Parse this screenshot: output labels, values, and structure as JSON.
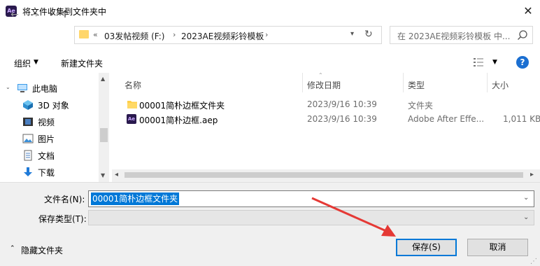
{
  "title": "将文件收集到文件夹中",
  "app_icon_text": "Ae",
  "address": {
    "overflow": "«",
    "crumbs": [
      "03发帖视频 (F:)",
      "2023AE视频彩铃模板"
    ]
  },
  "search": {
    "placeholder": "在 2023AE视频彩铃模板 中..."
  },
  "toolbar": {
    "organize": "组织",
    "new_folder": "新建文件夹"
  },
  "nav": {
    "items": [
      {
        "label": "此电脑",
        "icon": "pc-icon"
      },
      {
        "label": "3D 对象",
        "icon": "3d-objects-icon"
      },
      {
        "label": "视频",
        "icon": "video-icon"
      },
      {
        "label": "图片",
        "icon": "picture-icon"
      },
      {
        "label": "文档",
        "icon": "document-icon"
      },
      {
        "label": "下载",
        "icon": "download-icon"
      }
    ]
  },
  "columns": {
    "name": "名称",
    "modified": "修改日期",
    "type": "类型",
    "size": "大小"
  },
  "files": [
    {
      "name": "00001简朴边框文件夹",
      "modified": "2023/9/16 10:39",
      "type": "文件夹",
      "size": "",
      "icon": "folder-icon"
    },
    {
      "name": "00001简朴边框.aep",
      "modified": "2023/9/16 10:39",
      "type": "Adobe After Effe...",
      "size": "1,011 KB",
      "icon": "ae-file-icon"
    }
  ],
  "form": {
    "filename_label": "文件名(N):",
    "filename_value": "00001简朴边框文件夹",
    "filetype_label": "保存类型(T):"
  },
  "footer": {
    "hide_folders": "隐藏文件夹",
    "save": "保存(S)",
    "cancel": "取消"
  },
  "colors": {
    "accent": "#0078d7",
    "annotation": "#e53935"
  }
}
